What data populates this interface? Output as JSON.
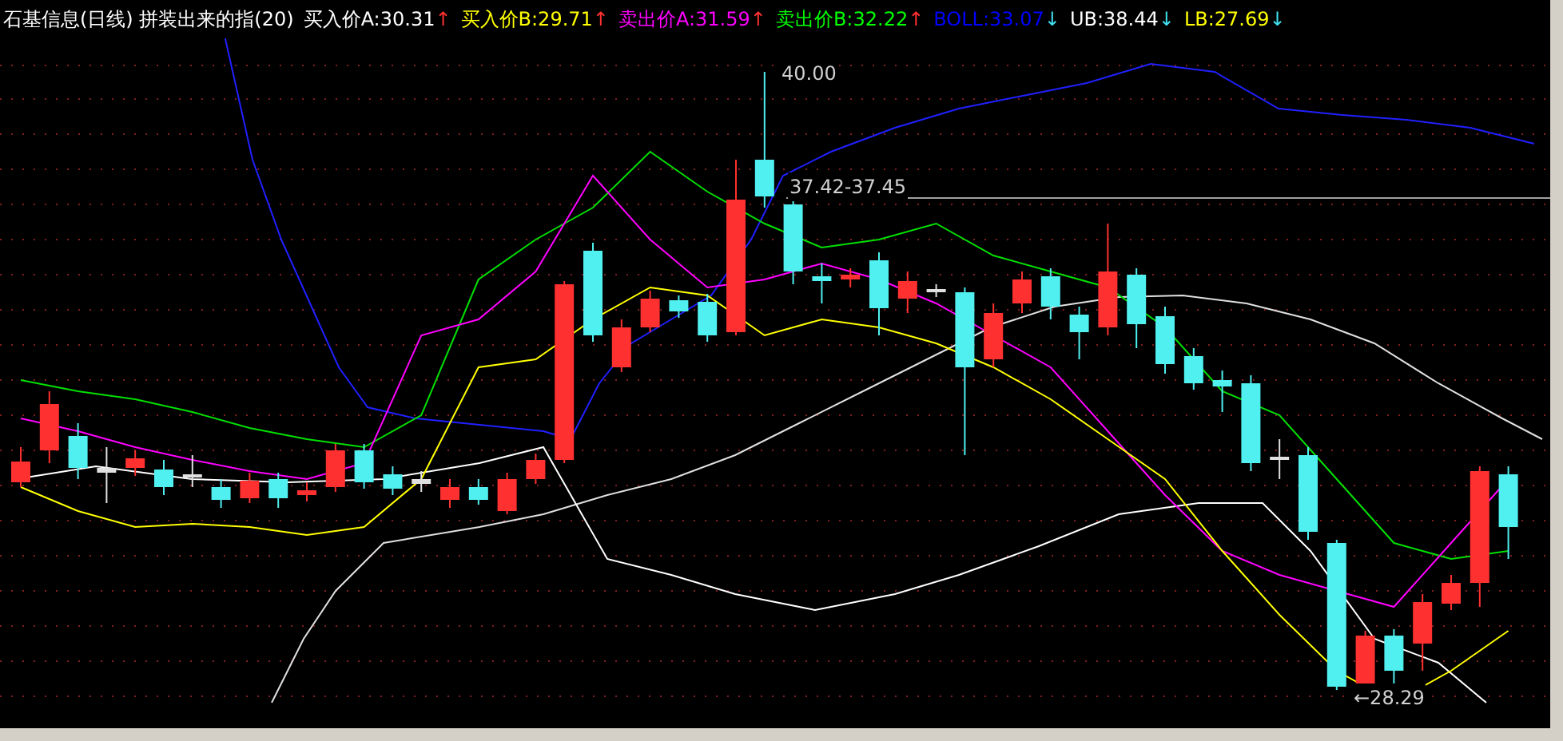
{
  "chart": {
    "title": "石基信息(日线) 拼装出来的指(20)",
    "legend": [
      {
        "label": "买入价A:30.31",
        "color": "#ffffff",
        "arrow": {
          "text": "↑",
          "color": "#ff3030"
        }
      },
      {
        "label": "买入价B:29.71",
        "color": "#ffff00",
        "arrow": {
          "text": "↑",
          "color": "#ff3030"
        }
      },
      {
        "label": "卖出价A:31.59",
        "color": "#ff00ff",
        "arrow": {
          "text": "↑",
          "color": "#ff3030"
        }
      },
      {
        "label": "卖出价B:32.22",
        "color": "#00ff00",
        "arrow": {
          "text": "↑",
          "color": "#ff3030"
        }
      },
      {
        "label": "BOLL:33.07",
        "color": "#0000ff",
        "arrow": {
          "text": "↓",
          "color": "#40e0f0"
        }
      },
      {
        "label": "UB:38.44",
        "color": "#ffffff",
        "arrow": {
          "text": "↓",
          "color": "#40e0f0"
        }
      },
      {
        "label": "LB:27.69",
        "color": "#ffff00",
        "arrow": {
          "text": "↓",
          "color": "#40e0f0"
        }
      }
    ],
    "price_labels": [
      {
        "text": "40.00"
      },
      {
        "text": "37.42-37.45"
      },
      {
        "text": "←28.29"
      }
    ]
  }
}
